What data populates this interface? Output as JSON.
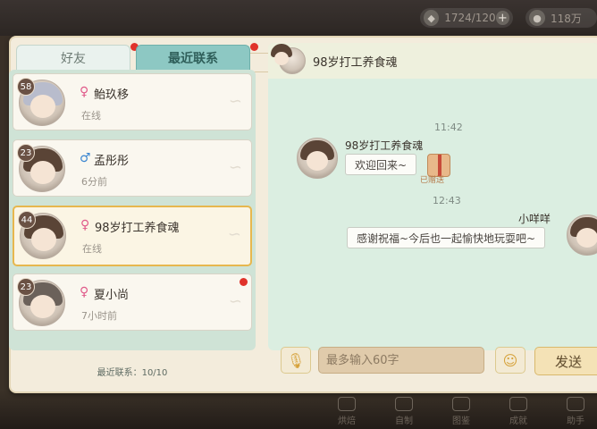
{
  "top_bar": {
    "stamina_value": "1724/120",
    "gold_value": "118万"
  },
  "panel": {
    "title": "好友"
  },
  "tabs": [
    {
      "label": "好友",
      "has_dot": true,
      "active": false
    },
    {
      "label": "最近联系",
      "has_dot": true,
      "active": true
    }
  ],
  "friends": [
    {
      "level": "58",
      "gender": "♀",
      "name": "鲐玖移",
      "status": "在线",
      "active": false,
      "has_dot": false
    },
    {
      "level": "23",
      "gender": "♂",
      "name": "孟彤彤",
      "status": "6分前",
      "active": false,
      "has_dot": false
    },
    {
      "level": "44",
      "gender": "♀",
      "name": "98岁打工养食魂",
      "status": "在线",
      "active": true,
      "has_dot": false
    },
    {
      "level": "23",
      "gender": "♀",
      "name": "夏小尚",
      "status": "7小时前",
      "active": false,
      "has_dot": true
    }
  ],
  "recent_count": "最近联系：10/10",
  "chat": {
    "header_name": "98岁打工养食魂",
    "messages": [
      {
        "time": "11:42",
        "sender": "98岁打工养食魂",
        "text": "欢迎回来~",
        "side": "left",
        "gift_label": "已赠送"
      },
      {
        "time": "12:43",
        "sender": "小咩咩",
        "text": "感谢祝福~今后也一起愉快地玩耍吧~",
        "side": "right"
      }
    ],
    "input_placeholder": "最多输入60字",
    "send_label": "发送"
  },
  "icons": {
    "stamina": "crystal-icon",
    "gold": "coin-icon",
    "mic": "microphone-icon",
    "emoji": "emoji-icon",
    "gift": "gift-icon"
  },
  "colors": {
    "accent_teal": "#8dc8c3",
    "active_border": "#e7b74e",
    "notification_dot": "#e0322a"
  },
  "bottom_nav": [
    {
      "label": "烘焙"
    },
    {
      "label": "自制"
    },
    {
      "label": "图鉴"
    },
    {
      "label": "成就"
    },
    {
      "label": "助手"
    }
  ]
}
